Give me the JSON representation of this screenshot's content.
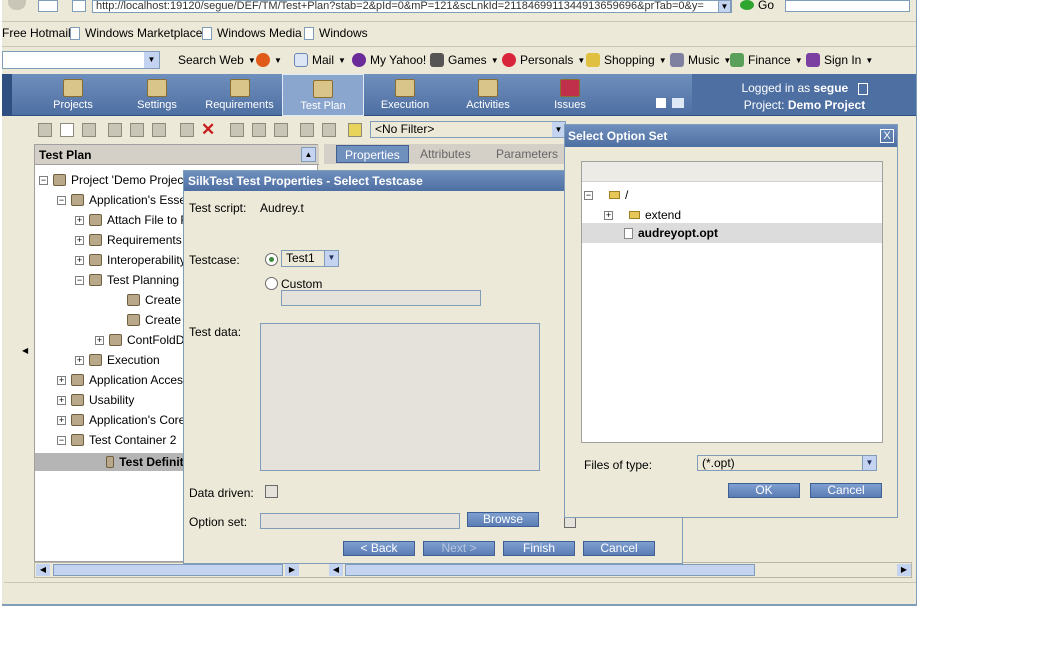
{
  "browser": {
    "address": "http://localhost:19120/segue/DEF/TM/Test+Plan?stab=2&pId=0&mP=121&scLnkId=2118469911344913659696&prTab=0&y=",
    "go_label": "Go",
    "links": [
      "Free Hotmail",
      "Windows Marketplace",
      "Windows Media",
      "Windows"
    ]
  },
  "yahoo_bar": {
    "items": [
      "Search Web",
      "Mail",
      "My Yahoo!",
      "Games",
      "Personals",
      "Shopping",
      "Music",
      "Finance",
      "Sign In"
    ]
  },
  "nav": {
    "tabs": [
      "Projects",
      "Settings",
      "Requirements",
      "Test Plan",
      "Execution",
      "Activities",
      "Issues"
    ],
    "active_tab": "Test Plan",
    "logged_in_prefix": "Logged in as",
    "user": "segue",
    "project_prefix": "Project:",
    "project": "Demo Project"
  },
  "toolbar": {
    "filter_value": "<No Filter>"
  },
  "tree": {
    "header": "Test Plan",
    "nodes": [
      {
        "label": "Project 'Demo Project'",
        "expander": "−"
      },
      {
        "label": "Application's Essen",
        "expander": "−"
      },
      {
        "label": "Attach File to R",
        "expander": "+"
      },
      {
        "label": "Requirements M",
        "expander": "+"
      },
      {
        "label": "Interoperability",
        "expander": "+"
      },
      {
        "label": "Test Planning",
        "expander": "−"
      },
      {
        "label": "Create Silk",
        "expander": ""
      },
      {
        "label": "Create Silk",
        "expander": ""
      },
      {
        "label": "ContFoldDe",
        "expander": "+"
      },
      {
        "label": "Execution",
        "expander": "+"
      },
      {
        "label": "Application Access",
        "expander": "+"
      },
      {
        "label": "Usability",
        "expander": "+"
      },
      {
        "label": "Application's Core F",
        "expander": "+"
      },
      {
        "label": "Test Container 2",
        "expander": "−"
      },
      {
        "label": "Test Definiti",
        "expander": ""
      }
    ]
  },
  "right_tabs": [
    "Properties",
    "Attributes",
    "Parameters"
  ],
  "testcase_dialog": {
    "title": "SilkTest Test Properties - Select Testcase",
    "test_script_label": "Test script:",
    "test_script_value": "Audrey.t",
    "testcase_label": "Testcase:",
    "testcase_value": "Test1",
    "custom_label": "Custom",
    "test_data_label": "Test data:",
    "data_driven_label": "Data driven:",
    "option_set_label": "Option set:",
    "browse_label": "Browse",
    "back_label": "< Back",
    "next_label": "Next >",
    "finish_label": "Finish",
    "cancel_label": "Cancel"
  },
  "option_dialog": {
    "title": "Select Option Set",
    "close_label": "X",
    "root": "/",
    "folder": "extend",
    "file": "audreyopt.opt",
    "files_of_type_label": "Files of type:",
    "files_of_type_value": "(*.opt)",
    "ok_label": "OK",
    "cancel_label": "Cancel"
  }
}
